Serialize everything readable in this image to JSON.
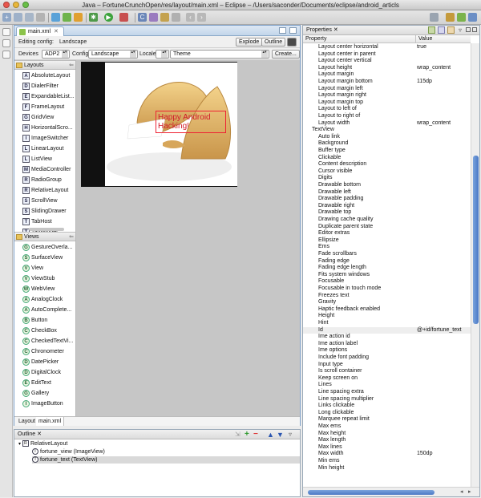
{
  "window": {
    "title": "Java – FortuneCrunchOpen/res/layout/main.xml – Eclipse – /Users/saconder/Documents/eclipse/android_articls"
  },
  "editor": {
    "tab_label": "main.xml",
    "editing_config_label": "Editing config:",
    "editing_config_value": "Landscape",
    "explode_label": "Explode",
    "outline_label": "Outline",
    "devices_label": "Devices",
    "devices_value": "ADP2",
    "config_label": "Config",
    "config_value": "Landscape",
    "locale_label": "Locale",
    "locale_value": "",
    "theme_value": "Theme",
    "create_label": "Create..."
  },
  "palette": {
    "layouts_label": "Layouts",
    "layouts": [
      "AbsoluteLayout",
      "DialerFilter",
      "ExpandableList...",
      "FrameLayout",
      "GridView",
      "HorizontalScro...",
      "ImageSwitcher",
      "LinearLayout",
      "ListView",
      "MediaController",
      "RadioGroup",
      "RelativeLayout",
      "ScrollView",
      "SlidingDrawer",
      "TabHost",
      "TabWidget"
    ],
    "layout_letters": [
      "A",
      "D",
      "E",
      "F",
      "G",
      "H",
      "I",
      "L",
      "L",
      "M",
      "R",
      "R",
      "S",
      "S",
      "T",
      "T"
    ],
    "views_label": "Views",
    "views": [
      "GestureOverla...",
      "SurfaceView",
      "View",
      "ViewStub",
      "WebView",
      "AnalogClock",
      "AutoComplete...",
      "Button",
      "CheckBox",
      "CheckedTextVi...",
      "Chronometer",
      "DatePicker",
      "DigitalClock",
      "EditText",
      "Gallery",
      "ImageButton"
    ],
    "view_letters": [
      "G",
      "S",
      "V",
      "V",
      "W",
      "A",
      "A",
      "B",
      "C",
      "C",
      "C",
      "D",
      "D",
      "E",
      "G",
      "I"
    ]
  },
  "preview": {
    "text": "Happy Android Hacking!"
  },
  "bottom_tabs": {
    "layout": "Layout",
    "xml": "main.xml"
  },
  "outline": {
    "tab_label": "Outline",
    "root": "RelativeLayout",
    "children": [
      {
        "label": "fortune_view (ImageView)",
        "letter": "I"
      },
      {
        "label": "fortune_text (TextView)",
        "letter": "T"
      }
    ]
  },
  "properties": {
    "tab_label": "Properties",
    "col_property": "Property",
    "col_value": "Value",
    "rows": [
      {
        "name": "Layout center horizontal",
        "value": "true"
      },
      {
        "name": "Layout center in parent",
        "value": ""
      },
      {
        "name": "Layout center vertical",
        "value": ""
      },
      {
        "name": "Layout height",
        "value": "wrap_content"
      },
      {
        "name": "Layout margin",
        "value": ""
      },
      {
        "name": "Layout margin bottom",
        "value": "115dp"
      },
      {
        "name": "Layout margin left",
        "value": ""
      },
      {
        "name": "Layout margin right",
        "value": ""
      },
      {
        "name": "Layout margin top",
        "value": ""
      },
      {
        "name": "Layout to left of",
        "value": ""
      },
      {
        "name": "Layout to right of",
        "value": ""
      },
      {
        "name": "Layout width",
        "value": "wrap_content"
      },
      {
        "name": "TextView",
        "value": "",
        "category": true
      },
      {
        "name": "Auto link",
        "value": ""
      },
      {
        "name": "Background",
        "value": ""
      },
      {
        "name": "Buffer type",
        "value": ""
      },
      {
        "name": "Clickable",
        "value": ""
      },
      {
        "name": "Content description",
        "value": ""
      },
      {
        "name": "Cursor visible",
        "value": ""
      },
      {
        "name": "Digits",
        "value": ""
      },
      {
        "name": "Drawable bottom",
        "value": ""
      },
      {
        "name": "Drawable left",
        "value": ""
      },
      {
        "name": "Drawable padding",
        "value": ""
      },
      {
        "name": "Drawable right",
        "value": ""
      },
      {
        "name": "Drawable top",
        "value": ""
      },
      {
        "name": "Drawing cache quality",
        "value": ""
      },
      {
        "name": "Duplicate parent state",
        "value": ""
      },
      {
        "name": "Editor extras",
        "value": ""
      },
      {
        "name": "Ellipsize",
        "value": ""
      },
      {
        "name": "Ems",
        "value": ""
      },
      {
        "name": "Fade scrollbars",
        "value": ""
      },
      {
        "name": "Fading edge",
        "value": ""
      },
      {
        "name": "Fading edge length",
        "value": ""
      },
      {
        "name": "Fits system windows",
        "value": ""
      },
      {
        "name": "Focusable",
        "value": ""
      },
      {
        "name": "Focusable in touch mode",
        "value": ""
      },
      {
        "name": "Freezes text",
        "value": ""
      },
      {
        "name": "Gravity",
        "value": ""
      },
      {
        "name": "Haptic feedback enabled",
        "value": ""
      },
      {
        "name": "Height",
        "value": ""
      },
      {
        "name": "Hint",
        "value": ""
      },
      {
        "name": "Id",
        "value": "@+id/fortune_text"
      },
      {
        "name": "Ime action id",
        "value": ""
      },
      {
        "name": "Ime action label",
        "value": ""
      },
      {
        "name": "Ime options",
        "value": ""
      },
      {
        "name": "Include font padding",
        "value": ""
      },
      {
        "name": "Input type",
        "value": ""
      },
      {
        "name": "Is scroll container",
        "value": ""
      },
      {
        "name": "Keep screen on",
        "value": ""
      },
      {
        "name": "Lines",
        "value": ""
      },
      {
        "name": "Line spacing extra",
        "value": ""
      },
      {
        "name": "Line spacing multiplier",
        "value": ""
      },
      {
        "name": "Links clickable",
        "value": ""
      },
      {
        "name": "Long clickable",
        "value": ""
      },
      {
        "name": "Marquee repeat limit",
        "value": ""
      },
      {
        "name": "Max ems",
        "value": ""
      },
      {
        "name": "Max height",
        "value": ""
      },
      {
        "name": "Max length",
        "value": ""
      },
      {
        "name": "Max lines",
        "value": ""
      },
      {
        "name": "Max width",
        "value": "150dp"
      },
      {
        "name": "Min ems",
        "value": ""
      },
      {
        "name": "Min height",
        "value": ""
      }
    ]
  },
  "colors": {
    "accent": "#4a78c5",
    "preview_text": "#d1192a",
    "canvas": "#c6c6c6"
  }
}
